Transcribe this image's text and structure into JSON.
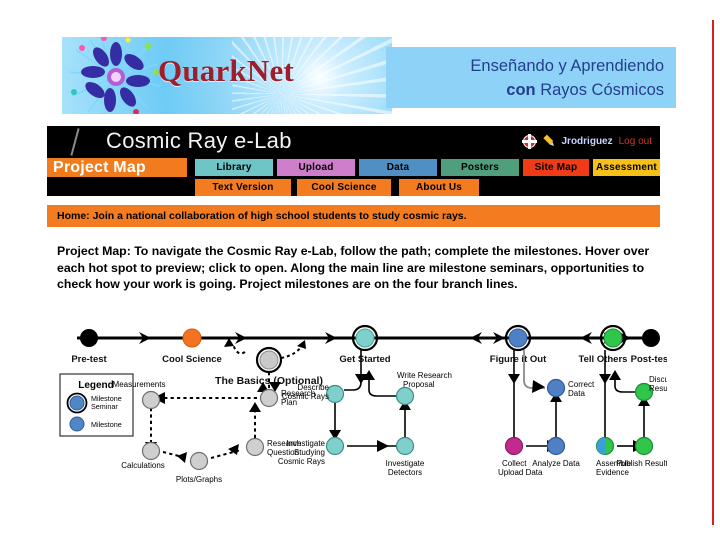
{
  "slide": {
    "accent_red": "#d62020",
    "banner_blue": "#8ed3f7",
    "orange": "#f47c20"
  },
  "quarknet": {
    "wordmark": "QuarkNet",
    "logo_icon": "starburst-icon"
  },
  "title": {
    "line1": "Enseñando y Aprendiendo",
    "line2_bold": "con",
    "line2_rest": " Rayos Cósmicos"
  },
  "elab": {
    "app_title": "Cosmic Ray e-Lab",
    "user": "Jrodriguez",
    "logout": "Log out",
    "lifering_icon": "life-ring-icon",
    "pencil_icon": "pencil-icon",
    "tabs_row1": [
      {
        "label": "Project Map",
        "color": "#f27c1d",
        "text": "#ffffff"
      },
      {
        "label": "Library",
        "color": "#6fc4c6",
        "text": "#000000"
      },
      {
        "label": "Upload",
        "color": "#cf7ecb",
        "text": "#000000"
      },
      {
        "label": "Data",
        "color": "#4f8fc4",
        "text": "#000000"
      },
      {
        "label": "Posters",
        "color": "#4f9e7c",
        "text": "#000000"
      },
      {
        "label": "Site Map",
        "color": "#f03c16",
        "text": "#000000"
      },
      {
        "label": "Assessment",
        "color": "#f5c018",
        "text": "#000000"
      }
    ],
    "tabs_row2": [
      {
        "label": "Text Version",
        "color": "#f47c20",
        "text": "#000000"
      },
      {
        "label": "Cool Science",
        "color": "#f47c20",
        "text": "#000000"
      },
      {
        "label": "About Us",
        "color": "#f47c20",
        "text": "#000000"
      }
    ],
    "home_banner": "Home: Join a national collaboration of high school students to study cosmic rays."
  },
  "description": "Project Map: To navigate the Cosmic Ray e-Lab, follow the path; complete the milestones. Hover over each hot spot to preview; click to open. Along the main line are milestone seminars, opportunities to check how your work is going. Project milestones are on the four branch lines.",
  "project_map": {
    "legend": {
      "title": "Legend",
      "items": [
        {
          "label": "Milestone Seminar",
          "color": "#4e86c6",
          "ring": true
        },
        {
          "label": "Milestone",
          "color": "#4e86c6",
          "ring": false
        }
      ]
    },
    "timeline": [
      {
        "label": "Pre-test",
        "color": "#000000",
        "ring": false
      },
      {
        "label": "Cool Science",
        "color": "#f47320",
        "ring": false
      },
      {
        "label": "The Basics (Optional)",
        "color": "#c9c9c9",
        "ring": true
      },
      {
        "label": "Get Started",
        "color": "#7fcfcb",
        "ring": true
      },
      {
        "label": "Figure it Out",
        "color": "#4f7fc4",
        "ring": true
      },
      {
        "label": "Tell Others",
        "color": "#2fc64b",
        "ring": true
      },
      {
        "label": "Post-test",
        "color": "#000000",
        "ring": false
      }
    ],
    "branch_basics": [
      {
        "label": "Measurements",
        "color": "#cfcfcf"
      },
      {
        "label": "Research Plan",
        "color": "#cfcfcf"
      },
      {
        "label": "Calculations",
        "color": "#cfcfcf"
      },
      {
        "label": "Plots/Graphs",
        "color": "#cfcfcf"
      },
      {
        "label": "Research Question",
        "color": "#cfcfcf"
      }
    ],
    "branch_get_started": [
      {
        "label": "Describe Cosmic Rays",
        "color": "#7fcfcb"
      },
      {
        "label": "Write Research Proposal",
        "color": "#7fcfcb"
      },
      {
        "label": "Investigate Studying Cosmic Rays",
        "color": "#7fcfcb"
      },
      {
        "label": "Investigate Detectors",
        "color": "#7fcfcb"
      }
    ],
    "branch_figure_it_out": [
      {
        "label": "Collect Upload Data",
        "color": "#c32a8f"
      },
      {
        "label": "Correct Data",
        "color": "#4f7fc4"
      },
      {
        "label": "Analyze Data",
        "color": "#4f7fc4"
      }
    ],
    "branch_tell_others": [
      {
        "label": "Assemble Evidence",
        "color": "#2fc64b"
      },
      {
        "label": "Publish Results",
        "color": "#2fc64b"
      },
      {
        "label": "Discuss Results",
        "color": "#2fc64b"
      }
    ]
  }
}
